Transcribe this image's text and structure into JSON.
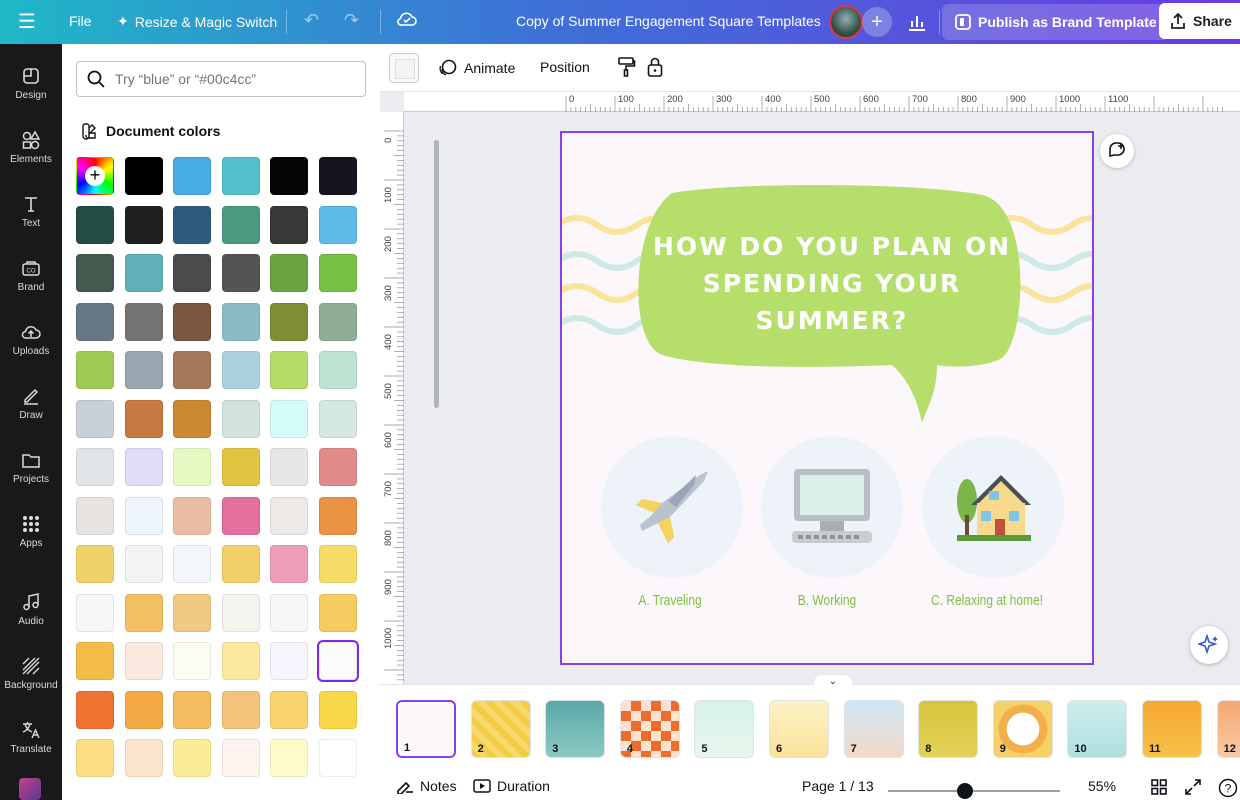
{
  "topbar": {
    "file": "File",
    "resize": "Resize & Magic Switch",
    "title": "Copy of Summer Engagement Square Templates",
    "publish": "Publish as Brand Template",
    "share": "Share"
  },
  "rail": {
    "items": [
      {
        "label": "Design",
        "icon": "design-icon"
      },
      {
        "label": "Elements",
        "icon": "elements-icon"
      },
      {
        "label": "Text",
        "icon": "text-icon"
      },
      {
        "label": "Brand",
        "icon": "brand-icon"
      },
      {
        "label": "Uploads",
        "icon": "uploads-icon"
      },
      {
        "label": "Draw",
        "icon": "draw-icon"
      },
      {
        "label": "Projects",
        "icon": "projects-icon"
      },
      {
        "label": "Apps",
        "icon": "apps-icon"
      },
      {
        "label": "Audio",
        "icon": "audio-icon"
      },
      {
        "label": "Background",
        "icon": "background-icon"
      },
      {
        "label": "Translate",
        "icon": "translate-icon"
      }
    ]
  },
  "panel": {
    "search_placeholder": "Try “blue” or “#00c4cc”",
    "section_title": "Document colors",
    "colors": [
      "#000000",
      "#49aee8",
      "#52bfca",
      "#050505",
      "#14141f",
      "#234d44",
      "#1f1f1f",
      "#2f5a80",
      "#4a9b7e",
      "#383838",
      "#5ebae6",
      "#45594c",
      "#60b1b7",
      "#4b4b4b",
      "#545454",
      "#6aa341",
      "#76c043",
      "#687785",
      "#737373",
      "#7a5540",
      "#8abcc4",
      "#7e8e34",
      "#90ae95",
      "#9ecb54",
      "#9aa6b0",
      "#a57a5a",
      "#aed1de",
      "#b5dd66",
      "#bfe3d2",
      "#c9d0d8",
      "#c67940",
      "#cc8830",
      "#d4e2de",
      "#d3fcfb",
      "#d5e9e2",
      "#e1e5e9",
      "#e1ddf6",
      "#e8fac4",
      "#e3c440",
      "#e6e7e7",
      "#e08a8a",
      "#e7e3e1",
      "#eef5fc",
      "#e9bea5",
      "#e46e9c",
      "#ece9e6",
      "#ea9244",
      "#f0d26a",
      "#f3f3f3",
      "#f3f6fa",
      "#f1d06a",
      "#ee9fb7",
      "#f5dc68",
      "#f7f7f7",
      "#f2c062",
      "#f1c983",
      "#f5f3ee",
      "#f6f6f7",
      "#f4cc60",
      "#f3bb47",
      "#faeadf",
      "#fbfdf3",
      "#fce99e",
      "#f8f4fd",
      "#fbfbfb",
      "#ef7230",
      "#f4a843",
      "#f5bb61",
      "#f5c27c",
      "#f8d36e",
      "#f8d849",
      "#fcdf84",
      "#fbe5cc",
      "#fbec98",
      "#fdf3ef",
      "#fefbc8",
      "#ffffff"
    ]
  },
  "toolbar": {
    "animate": "Animate",
    "position": "Position"
  },
  "rulers": {
    "top": [
      "0",
      "100",
      "200",
      "300",
      "400",
      "500",
      "600",
      "700",
      "800",
      "900",
      "1000",
      "1100"
    ],
    "left": [
      "0",
      "100",
      "200",
      "300",
      "400",
      "500",
      "600",
      "700",
      "800",
      "900",
      "1000"
    ]
  },
  "canvas": {
    "question": "How do you plan on spending your summer?",
    "options": [
      "A. Traveling",
      "B. Working",
      "C. Relaxing at home!"
    ],
    "bubble_color": "#b5df6a"
  },
  "filmstrip": {
    "pages": [
      "1",
      "2",
      "3",
      "4",
      "5",
      "6",
      "7",
      "8",
      "9",
      "10",
      "11",
      "12"
    ]
  },
  "footer": {
    "notes": "Notes",
    "duration": "Duration",
    "page": "Page 1 / 13",
    "zoom": "55%",
    "zoom_fraction": 0.45
  }
}
